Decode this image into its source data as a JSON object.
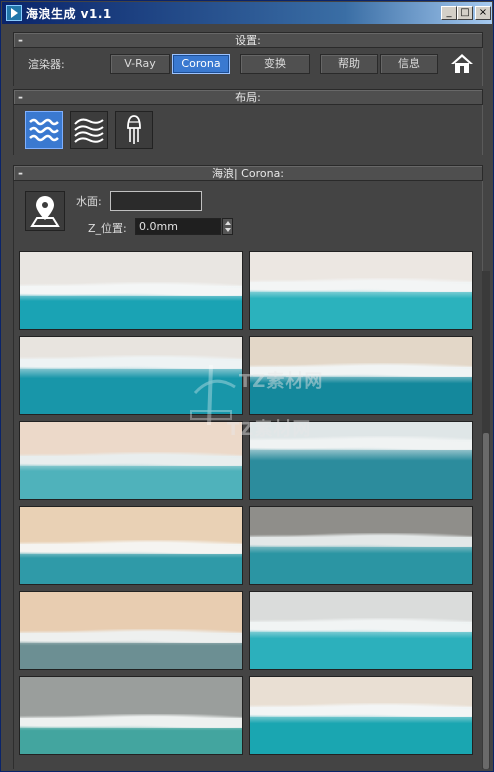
{
  "window": {
    "title": "海浪生成 v1.1",
    "buttons": {
      "minimize": "_",
      "maximize": "□",
      "close": "×"
    }
  },
  "settings": {
    "header": "设置:",
    "collapse": "-",
    "renderer_label": "渲染器:",
    "renderers": [
      "V-Ray",
      "Corona"
    ],
    "active_renderer": "Corona",
    "convert": "变换",
    "help": "帮助",
    "info": "信息",
    "home_icon": "home-icon"
  },
  "layout": {
    "header": "布局:",
    "collapse": "-",
    "buttons": [
      {
        "icon": "waves-icon",
        "active": true
      },
      {
        "icon": "waves-outline-icon",
        "active": false
      },
      {
        "icon": "jellyfish-icon",
        "active": false
      }
    ]
  },
  "waves": {
    "header": "海浪| Corona:",
    "collapse": "-",
    "pick_icon": "map-pin-icon",
    "water_surface_label": "水面:",
    "water_surface_value": "",
    "z_position_label": "Z_位置:",
    "z_position_value": "0.0mm"
  },
  "thumbnails": [
    {
      "sand": "#e9e6e2",
      "sea": "#1aa3b4",
      "sea_height": 0.55,
      "foam": "#f4f6f6"
    },
    {
      "sand": "#ece7e2",
      "sea": "#2bb2bd",
      "sea_height": 0.6,
      "foam": "#f3f5f5"
    },
    {
      "sand": "#e8e4df",
      "sea": "#1896a9",
      "sea_height": 0.7,
      "foam": "#eef3f4"
    },
    {
      "sand": "#e3d7c8",
      "sea": "#14889c",
      "sea_height": 0.6,
      "foam": "#f1f4f4"
    },
    {
      "sand": "#ecd9c9",
      "sea": "#4fb2bb",
      "sea_height": 0.55,
      "foam": "#e9eeee"
    },
    {
      "sand": "#dfe6e7",
      "sea": "#2c8c9d",
      "sea_height": 0.75,
      "foam": "#f0f3f3"
    },
    {
      "sand": "#e9d1b5",
      "sea": "#2f9aa8",
      "sea_height": 0.5,
      "foam": "#f5f4f1"
    },
    {
      "sand": "#8f8e8a",
      "sea": "#2b95a3",
      "sea_height": 0.6,
      "foam": "#e4e8e8"
    },
    {
      "sand": "#e8cdb1",
      "sea": "#6c8f93",
      "sea_height": 0.45,
      "foam": "#eef0ef"
    },
    {
      "sand": "#dadcdb",
      "sea": "#2cb0bc",
      "sea_height": 0.6,
      "foam": "#f1f4f4"
    },
    {
      "sand": "#9a9e9c",
      "sea": "#43a59f",
      "sea_height": 0.45,
      "foam": "#eef1f0"
    },
    {
      "sand": "#e9dfd3",
      "sea": "#1aa6b1",
      "sea_height": 0.6,
      "foam": "#f3f5f5"
    }
  ],
  "watermark": {
    "line1": "TZ素材网",
    "line2": "TZ素材网"
  }
}
